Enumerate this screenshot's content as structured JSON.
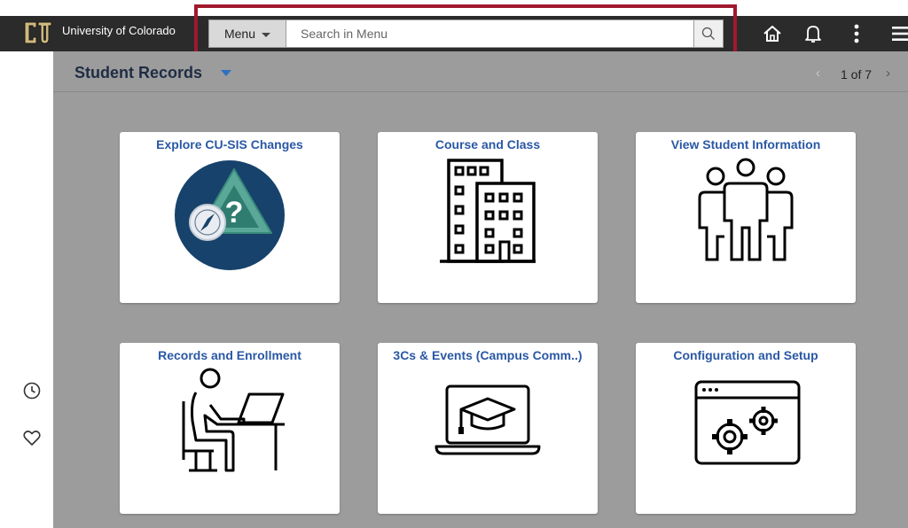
{
  "header": {
    "org_name": "University of Colorado",
    "menu_label": "Menu",
    "search_placeholder": "Search in Menu",
    "highlight_color": "#a0192d",
    "icons": [
      "home-icon",
      "bell-icon",
      "more-vertical-icon",
      "hamburger-icon"
    ]
  },
  "page": {
    "title": "Student Records",
    "pager": {
      "text": "1 of 7",
      "prev": "‹",
      "next": "›"
    }
  },
  "tiles": [
    {
      "title": "Explore CU-SIS Changes",
      "icon": "compass-question-icon"
    },
    {
      "title": "Course and Class",
      "icon": "buildings-icon"
    },
    {
      "title": "View Student Information",
      "icon": "people-icon"
    },
    {
      "title": "Records and Enrollment",
      "icon": "student-desk-icon"
    },
    {
      "title": "3Cs & Events (Campus Comm..)",
      "icon": "laptop-graduation-icon"
    },
    {
      "title": "Configuration and Setup",
      "icon": "browser-gears-icon"
    }
  ],
  "rail": {
    "icons": [
      "recent-history-icon",
      "favorites-heart-icon"
    ]
  }
}
